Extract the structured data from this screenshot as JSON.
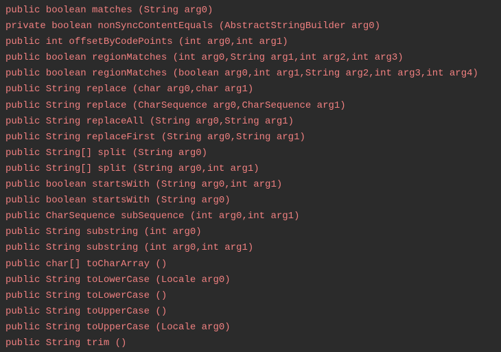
{
  "methods": [
    "public boolean matches (String arg0)",
    "private boolean nonSyncContentEquals (AbstractStringBuilder arg0)",
    "public int offsetByCodePoints (int arg0,int arg1)",
    "public boolean regionMatches (int arg0,String arg1,int arg2,int arg3)",
    "public boolean regionMatches (boolean arg0,int arg1,String arg2,int arg3,int arg4)",
    "public String replace (char arg0,char arg1)",
    "public String replace (CharSequence arg0,CharSequence arg1)",
    "public String replaceAll (String arg0,String arg1)",
    "public String replaceFirst (String arg0,String arg1)",
    "public String[] split (String arg0)",
    "public String[] split (String arg0,int arg1)",
    "public boolean startsWith (String arg0,int arg1)",
    "public boolean startsWith (String arg0)",
    "public CharSequence subSequence (int arg0,int arg1)",
    "public String substring (int arg0)",
    "public String substring (int arg0,int arg1)",
    "public char[] toCharArray ()",
    "public String toLowerCase (Locale arg0)",
    "public String toLowerCase ()",
    "public String toUpperCase ()",
    "public String toUpperCase (Locale arg0)",
    "public String trim ()"
  ]
}
